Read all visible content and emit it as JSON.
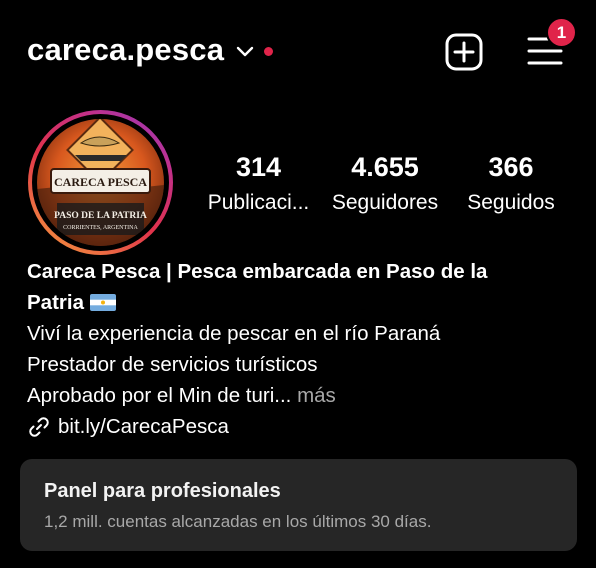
{
  "header": {
    "username": "careca.pesca",
    "notification_badge": "1",
    "accent_color": "#e0244a"
  },
  "icons": {
    "dropdown": "chevron-down-icon",
    "create": "plus-square-icon",
    "menu": "hamburger-menu-icon",
    "link": "link-icon"
  },
  "profile": {
    "avatar_text": {
      "top": "CARECA PESCA",
      "middle": "PASO DE LA PATRIA",
      "bottom": "CORRIENTES, ARGENTINA"
    },
    "stats": [
      {
        "value": "314",
        "label": "Publicaci..."
      },
      {
        "value": "4.655",
        "label": "Seguidores"
      },
      {
        "value": "366",
        "label": "Seguidos"
      }
    ],
    "bio": {
      "name_line1": "Careca Pesca | Pesca embarcada en Paso de la",
      "name_line2": "Patria",
      "lines": [
        "Viví la experiencia de pescar en el río Paraná",
        "Prestador de servicios turísticos",
        "Aprobado por el Min de turi..."
      ],
      "more_label": "más",
      "link": "bit.ly/CarecaPesca"
    }
  },
  "dashboard": {
    "title": "Panel para profesionales",
    "subtitle": "1,2 mill. cuentas alcanzadas en los últimos 30 días."
  }
}
